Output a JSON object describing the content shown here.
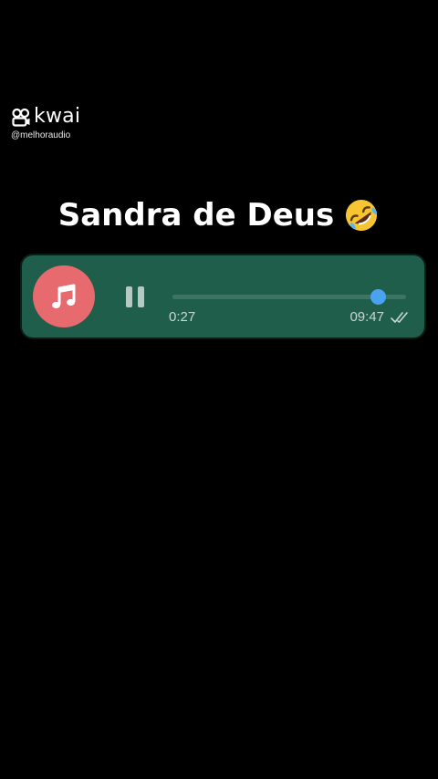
{
  "watermark": {
    "brand": "kwai",
    "handle": "@melhoraudio",
    "icon": "kwai-logo-icon"
  },
  "title": {
    "text": "Sandra de Deus",
    "emoji_icon": "rolling-on-floor-laughing-emoji-icon"
  },
  "audio_message": {
    "avatar_icon": "music-note-icon",
    "avatar_color": "#e66a6e",
    "bubble_color": "#1f5e4a",
    "state": "playing",
    "control_icon": "pause-icon",
    "elapsed": "0:27",
    "progress_fraction": 0.88,
    "thumb_color": "#4aa3f0",
    "sent_time": "09:47",
    "status_icon": "double-check-icon"
  }
}
